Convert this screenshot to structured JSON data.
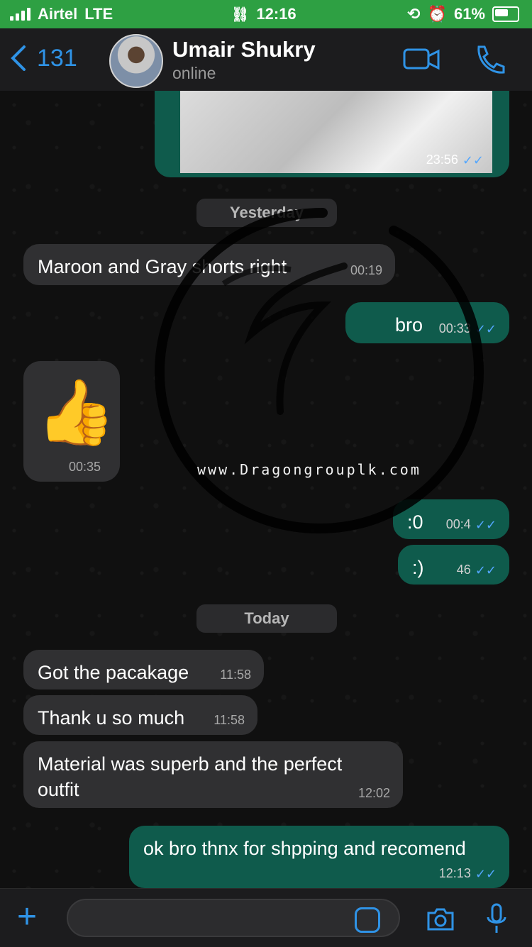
{
  "status": {
    "carrier": "Airtel",
    "network": "LTE",
    "time": "12:16",
    "battery": "61%"
  },
  "header": {
    "back_count": "131",
    "name": "Umair Shukry",
    "presence": "online"
  },
  "chat": {
    "media_time": "23:56",
    "date_yesterday": "Yesterday",
    "date_today": "Today",
    "messages": [
      {
        "text": "Maroon and Gray shorts right",
        "time": "00:19"
      },
      {
        "text": "bro",
        "time": "00:33"
      },
      {
        "text": "👍",
        "time": "00:35"
      },
      {
        "text": ":0",
        "time": "00:4"
      },
      {
        "text": ":)",
        "time": "46"
      },
      {
        "text": "Got the pacakage",
        "time": "11:58"
      },
      {
        "text": "Thank u so much",
        "time": "11:58"
      },
      {
        "text": "Material was superb and the perfect\noutfit",
        "time": "12:02"
      },
      {
        "text": "ok bro thnx for shpping and recomend",
        "time": "12:13"
      }
    ]
  },
  "watermark": {
    "url": "www.Dragongrouplk.com"
  },
  "colors": {
    "accent": "#2f93e6",
    "status_bar": "#2ea043",
    "outgoing_bubble": "#0f5b4c",
    "incoming_bubble": "#303032"
  }
}
